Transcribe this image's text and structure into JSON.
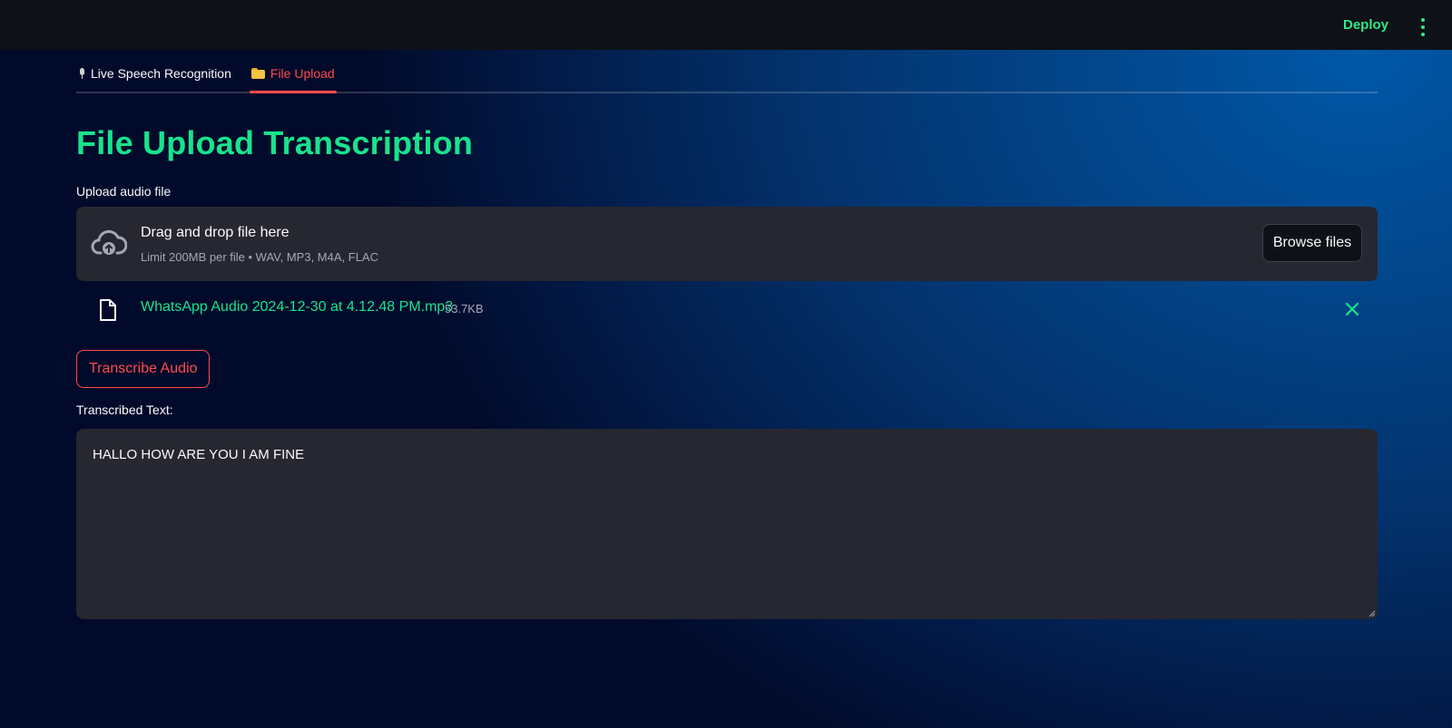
{
  "header": {
    "deploy_label": "Deploy",
    "menu_icon": "kebab-menu-icon"
  },
  "tabs": [
    {
      "label": "Live Speech Recognition",
      "icon": "microphone-icon",
      "active": false
    },
    {
      "label": "File Upload",
      "icon": "folder-icon",
      "active": true
    }
  ],
  "main": {
    "title": "File Upload Transcription",
    "upload_label": "Upload audio file",
    "dropzone": {
      "title": "Drag and drop file here",
      "limit": "Limit 200MB per file • WAV, MP3, M4A, FLAC",
      "browse_label": "Browse files",
      "icon": "cloud-upload-icon"
    },
    "uploaded_file": {
      "name": "WhatsApp Audio 2024-12-30 at 4.12.48 PM.mp3",
      "size": "53.7KB",
      "icon": "file-icon",
      "remove_icon": "close-icon"
    },
    "transcribe_label": "Transcribe Audio",
    "transcribed_label": "Transcribed Text:",
    "transcribed_text": "HALLO HOW ARE YOU I AM FINE"
  },
  "colors": {
    "accent_green": "#18e38d",
    "accent_red": "#ff4b4b",
    "panel_bg": "#262730",
    "header_bg": "#0e1117"
  }
}
